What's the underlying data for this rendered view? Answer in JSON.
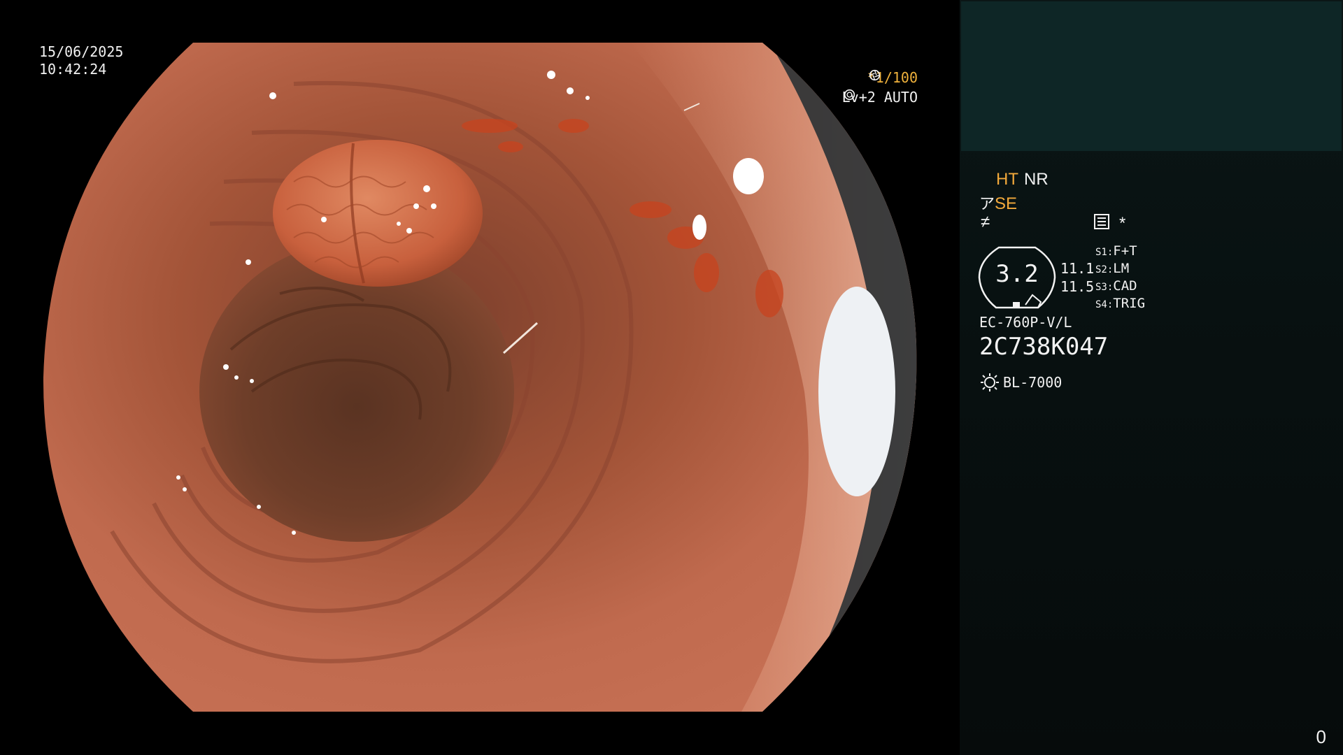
{
  "osd": {
    "date": "15/06/2025",
    "time": "10:42:24",
    "shutter": "*1/100",
    "shutter_icon": "aperture-icon",
    "level": "Lv+2 AUTO",
    "level_icon": "iris-icon"
  },
  "panel": {
    "ht": "HT",
    "nr": "NR",
    "se": "SE",
    "se_icon": "structure-enhance-icon",
    "ne_icon": "not-equal-icon",
    "menu_icon": "menu-list-icon",
    "star": "*",
    "ring_value": "3.2",
    "level_1": "11.1",
    "level_2": "11.5",
    "slots": [
      {
        "key": "S1:",
        "value": "F+T"
      },
      {
        "key": "S2:",
        "value": "LM"
      },
      {
        "key": "S3:",
        "value": "CAD"
      },
      {
        "key": "S4:",
        "value": "TRIG"
      }
    ],
    "scope_model": "EC-760P-V/L",
    "scope_serial": "2C738K047",
    "light_source": "BL-7000",
    "light_icon": "light-source-icon",
    "counter": "0"
  },
  "colors": {
    "accent": "#f2a93b",
    "panel_top": "#0e2626",
    "panel_bg": "#081111",
    "tissue": "#b9644a"
  }
}
